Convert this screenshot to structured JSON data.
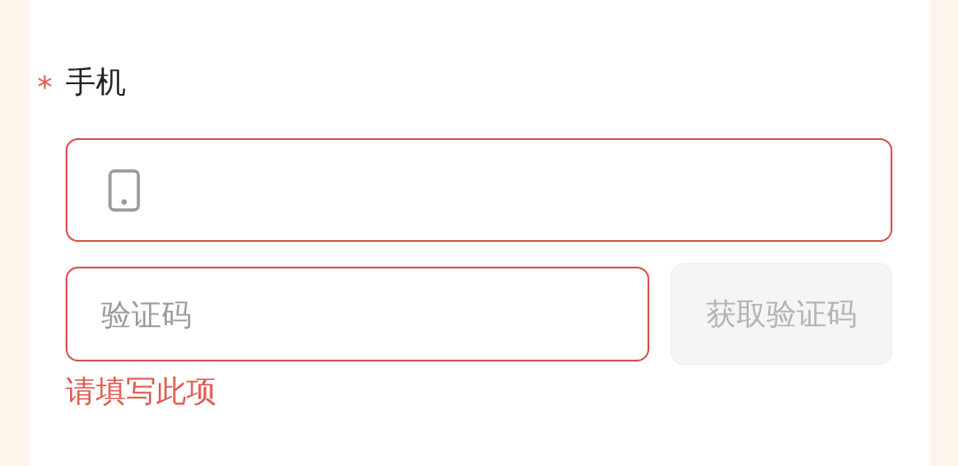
{
  "field": {
    "label": "手机",
    "required_mark": "*",
    "phone_input": {
      "invalid": true
    },
    "code_input": {
      "placeholder": "验证码",
      "invalid": true
    },
    "code_button": {
      "label": "获取验证码",
      "disabled": true
    },
    "error": "请填写此项"
  }
}
